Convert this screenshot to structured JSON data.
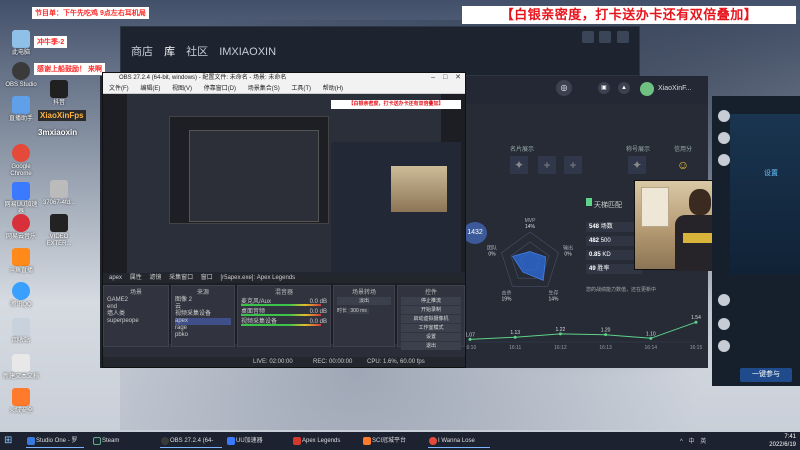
{
  "banner": "【白银亲密度，打卡送办卡还有双倍叠加】",
  "overlays": {
    "notice_1": "节目单：下午先吃鸡 9点左右耳机局",
    "notice_2": "冲牛季-2",
    "notice_3": "感谢上船鼓励！ 来啊",
    "streamer_handle": "3mxiaoxin",
    "fps_logo": "XiaoXinFps"
  },
  "desktop_icons": [
    {
      "label": "此电脑",
      "color": "#8fc1e8"
    },
    {
      "label": "OBS Studio",
      "color": "#3a3a3a"
    },
    {
      "label": "直播助手",
      "color": "#5fa0e8"
    },
    {
      "label": "抖音",
      "color": "#202020"
    },
    {
      "label": "Google Chrome",
      "color": "#e4493a"
    },
    {
      "label": "网易UU加速器",
      "color": "#3b79ff"
    },
    {
      "label": "网易云音乐",
      "color": "#d8303a"
    },
    {
      "label": "斗鱼直播",
      "color": "#ff8a1a"
    },
    {
      "label": "腾讯QQ",
      "color": "#3aa0ff"
    },
    {
      "label": "回收站",
      "color": "#c8d2dc"
    },
    {
      "label": "新建文本文档",
      "color": "#e8e8e8"
    },
    {
      "label": "火绒安全",
      "color": "#ff7a2a"
    },
    {
      "label": "VIDEO EXTER...",
      "color": "#222"
    },
    {
      "label": "37067-4fd...",
      "color": "#bbb"
    }
  ],
  "steam": {
    "nav": [
      "商店",
      "库",
      "社区",
      "IMXIAOXIN"
    ]
  },
  "apex": {
    "user_name": "XiaoXinF...",
    "level": "1432",
    "section_labels": [
      "名片展示",
      "称号展示",
      "信用分"
    ],
    "tianti_label": "天梯匹配",
    "stats": [
      {
        "label": "548",
        "value": "场数"
      },
      {
        "label": "482",
        "value": "500"
      },
      {
        "label": "0.85",
        "value": "KD"
      },
      {
        "label": "49",
        "value": "胜率"
      }
    ],
    "radar_labels": [
      "MVP",
      "输出",
      "生存",
      "击杀",
      "团队"
    ],
    "radar_values": [
      "14%",
      "0%",
      "14%",
      "19%",
      "0%"
    ],
    "footer_note": "您的战绩能力数值，还在更新中"
  },
  "chart_data": {
    "type": "line",
    "x": [
      "16:10",
      "16:11",
      "16:12",
      "16:13",
      "16:14",
      "16:15"
    ],
    "series": [
      {
        "values": [
          1.07,
          1.13,
          1.22,
          1.2,
          1.1,
          1.54
        ]
      }
    ],
    "data_labels": [
      "1.07",
      "1.13",
      "1.22",
      "1.20",
      "1.10",
      "1.54"
    ]
  },
  "right_panel": {
    "settings_label": "设置",
    "bottom_button": "一键参与"
  },
  "obs": {
    "title": "OBS 27.2.4 (64-bit, windows) - 配置文件: 未命名 - 场景: 未命名",
    "menu": [
      "文件(F)",
      "编辑(E)",
      "视图(V)",
      "停靠窗口(D)",
      "场景集合(S)",
      "工具(T)",
      "帮助(H)"
    ],
    "nested_banner": "【白银亲密度，打卡送办卡还有双倍叠加】",
    "dock_tabs": [
      "apex",
      "属性",
      "滤镜",
      "采集窗口",
      "窗口",
      "[r5apex.exe]: Apex Legends"
    ],
    "scenes_header": "场景",
    "scenes": [
      "GAME2",
      "end",
      "墙人类",
      "superpeope"
    ],
    "sources_header": "来源",
    "sources": [
      "图像 2",
      "云",
      "视频采集设备",
      "apex",
      "rage",
      "pbko"
    ],
    "mixer_header": "混音器",
    "mixer_items": [
      "麦克风/Aux",
      "桌面音频",
      "视频采集设备"
    ],
    "mixer_levels": [
      "0.0 dB",
      "0.0 dB",
      "0.0 dB"
    ],
    "transitions_header": "场景转场",
    "transition_type": "淡出",
    "transition_duration_label": "时长",
    "transition_duration": "300 ms",
    "controls_header": "控件",
    "controls": [
      "停止推流",
      "开始录制",
      "启动虚拟摄像机",
      "工作室模式",
      "设置",
      "退出"
    ],
    "status": {
      "live": "LIVE: 02:00:00",
      "rec": "REC: 00:00:00",
      "cpu": "CPU: 1.6%, 60.00 fps"
    }
  },
  "taskbar": {
    "items": [
      {
        "label": "Studio One - 罗兰...",
        "color": "#3a7adf"
      },
      {
        "label": "Steam",
        "color": "#1b2838"
      },
      {
        "label": "OBS 27.2.4 (64-bi...",
        "color": "#3a3a3a"
      },
      {
        "label": "UU加速器",
        "color": "#3b79ff"
      },
      {
        "label": "Apex Legends",
        "color": "#d33a2c"
      },
      {
        "label": "SCI冠城平台",
        "color": "#ff7a2a"
      },
      {
        "label": "I Wanna Lose You...",
        "color": "#e44a3a"
      }
    ],
    "time": "7:41",
    "date": "2022/6/19",
    "tray": [
      "^",
      "中",
      "英"
    ]
  }
}
